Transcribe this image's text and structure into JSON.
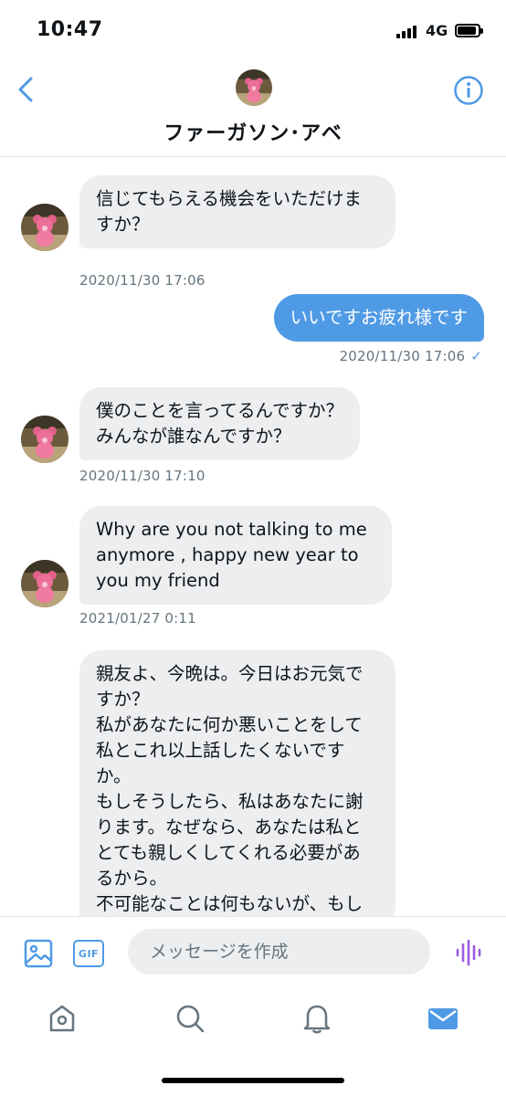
{
  "status_bar": {
    "time": "10:47",
    "network": "4G",
    "battery_level": 0.85
  },
  "header": {
    "name": "ファーガソン･アベ",
    "back_icon": "chevron-left-icon",
    "info_icon": "info-icon"
  },
  "messages": [
    {
      "direction": "in",
      "lines": [
        "信じてもらえる機会をいただけま",
        "すか？"
      ],
      "time": "2020/11/30 17:06"
    },
    {
      "direction": "out",
      "lines": [
        "いいですお疲れ様です"
      ],
      "time": "2020/11/30 17:06",
      "status": "✓"
    },
    {
      "direction": "in",
      "lines": [
        "僕のことを言ってるんですか？",
        "みんなが誰なんですか？"
      ],
      "time": "2020/11/30 17:10"
    },
    {
      "direction": "in",
      "lines": [
        "Why are you not talking to me",
        "anymore , happy new year to",
        "you my friend"
      ],
      "time": "2021/01/27 0:11"
    },
    {
      "direction": "in",
      "lines": [
        "親友よ、今晩は。今日はお元気で",
        "すか？",
        "私があなたに何か悪いことをして",
        "私とこれ以上話したくないです",
        "か。",
        "もしそうしたら、私はあなたに謝",
        "ります。なぜなら、あなたは私と",
        "とても親しくしてくれる必要があ",
        "るから。",
        "不可能なことは何もないが、もし"
      ]
    }
  ],
  "composer": {
    "placeholder": "メッセージを作成",
    "gif_label": "GIF",
    "image_icon": "image-icon",
    "voice_icon": "voice-waveform-icon"
  },
  "tabbar": {
    "items": [
      "home-icon",
      "search-icon",
      "notifications-icon",
      "messages-icon"
    ],
    "active": "messages-icon"
  },
  "colors": {
    "accent": "#4f9ae5",
    "bubble_in": "#eceef0",
    "voice": "#9b5de5"
  }
}
